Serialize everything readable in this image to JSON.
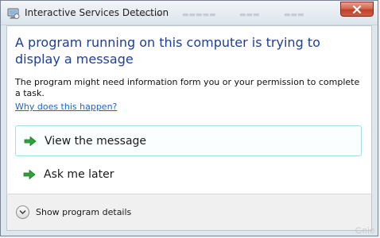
{
  "window": {
    "title": "Interactive Services Detection",
    "icon": "monitor-shield-icon",
    "close_icon": "close-icon"
  },
  "main": {
    "headline": "A program running on this computer is trying to display a message",
    "description": "The program might need information form you or your permission to complete a task.",
    "help_link": "Why does this happen?"
  },
  "commands": [
    {
      "label": "View the message",
      "icon": "green-arrow-icon"
    },
    {
      "label": "Ask me later",
      "icon": "green-arrow-icon"
    }
  ],
  "footer": {
    "details_label": "Show program details",
    "details_icon": "chevron-down-icon"
  },
  "watermark": "Gnie",
  "colors": {
    "headline": "#1b3f9a",
    "link": "#1a66c9",
    "arrow": "#2fa33a",
    "command_hover_border": "#a3dce6",
    "close_button": "#c0402a"
  }
}
